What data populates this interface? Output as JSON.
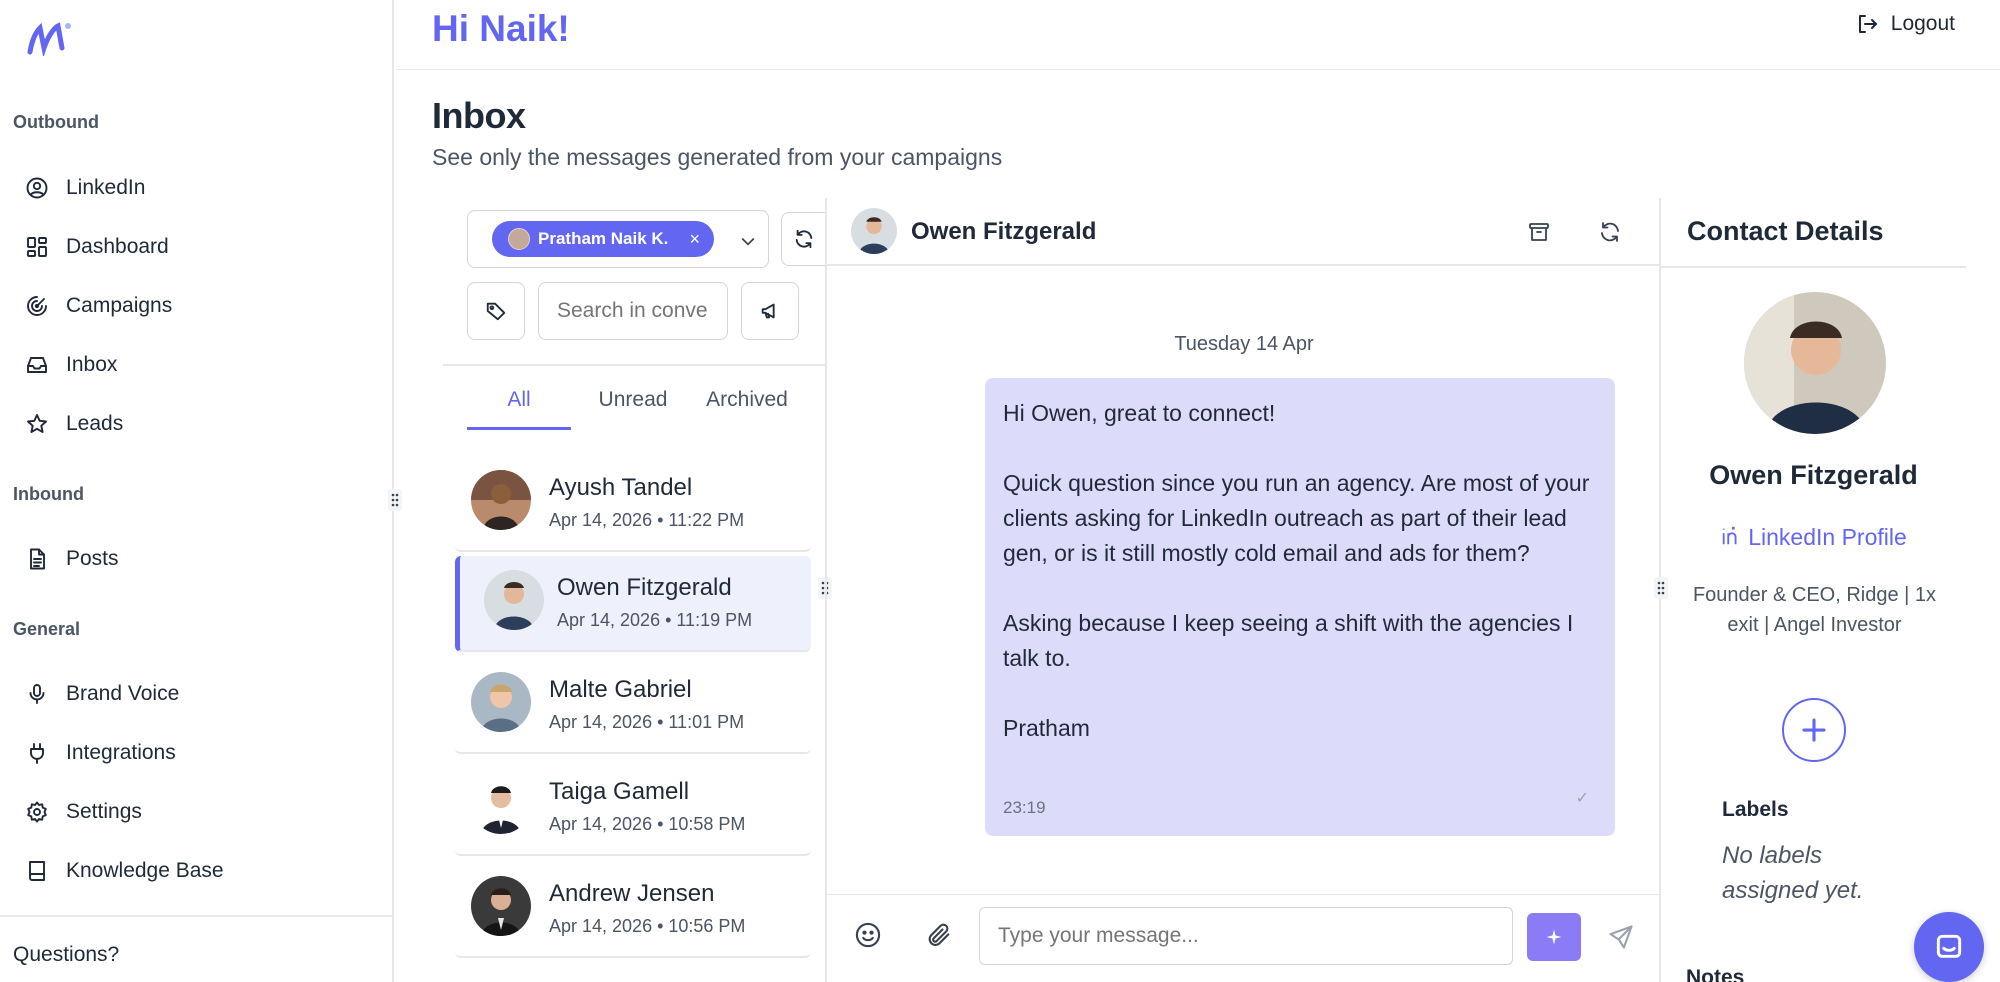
{
  "app": {
    "greeting": "Hi Naik!",
    "logout_label": "Logout",
    "questions_label": "Questions?"
  },
  "sidebar": {
    "sections": [
      {
        "title": "Outbound",
        "items": [
          {
            "label": "LinkedIn",
            "icon": "user-circle-icon"
          },
          {
            "label": "Dashboard",
            "icon": "dashboard-icon"
          },
          {
            "label": "Campaigns",
            "icon": "campaigns-icon"
          },
          {
            "label": "Inbox",
            "icon": "inbox-icon"
          },
          {
            "label": "Leads",
            "icon": "star-icon"
          }
        ]
      },
      {
        "title": "Inbound",
        "items": [
          {
            "label": "Posts",
            "icon": "document-icon"
          }
        ]
      },
      {
        "title": "General",
        "items": [
          {
            "label": "Brand Voice",
            "icon": "microphone-icon"
          },
          {
            "label": "Integrations",
            "icon": "plug-icon"
          },
          {
            "label": "Settings",
            "icon": "gear-icon"
          },
          {
            "label": "Knowledge Base",
            "icon": "book-icon"
          }
        ]
      }
    ]
  },
  "page": {
    "title": "Inbox",
    "subtitle": "See only the messages generated from your campaigns"
  },
  "filters": {
    "account_chip": "Pratham Naik K.",
    "chip_remove": "×",
    "search_placeholder": "Search in conve",
    "tabs": [
      {
        "label": "All",
        "active": true
      },
      {
        "label": "Unread"
      },
      {
        "label": "Archived"
      }
    ]
  },
  "conversations": [
    {
      "name": "Ayush Tandel",
      "time": "Apr 14, 2026 • 11:22 PM",
      "active": false
    },
    {
      "name": "Owen Fitzgerald",
      "time": "Apr 14, 2026 • 11:19 PM",
      "active": true
    },
    {
      "name": "Malte Gabriel",
      "time": "Apr 14, 2026 • 11:01 PM",
      "active": false
    },
    {
      "name": "Taiga Gamell",
      "time": "Apr 14, 2026 • 10:58 PM",
      "active": false
    },
    {
      "name": "Andrew Jensen",
      "time": "Apr 14, 2026 • 10:56 PM",
      "active": false
    }
  ],
  "chat": {
    "contact_name": "Owen Fitzgerald",
    "date_separator": "Tuesday 14 Apr",
    "message": {
      "lines": [
        "Hi Owen, great to connect!",
        "Quick question since you run an agency. Are most of your clients asking for LinkedIn outreach as part of their lead gen, or is it still mostly cold email and ads for them?",
        "Asking because I keep seeing a shift with the agencies I talk to.",
        "Pratham"
      ],
      "time": "23:19",
      "status": "✓"
    },
    "input_placeholder": "Type your message..."
  },
  "contact": {
    "panel_title": "Contact Details",
    "name": "Owen Fitzgerald",
    "linkedin_label": "LinkedIn Profile",
    "headline": "Founder & CEO, Ridge | 1x exit | Angel Investor",
    "labels_title": "Labels",
    "labels_empty": "No labels assigned yet.",
    "notes_title": "Notes"
  },
  "colors": {
    "accent": "#6366f1",
    "bubble": "#dcdcfa",
    "active_row": "#eef0fc",
    "ai_button": "#8b7cf6"
  }
}
